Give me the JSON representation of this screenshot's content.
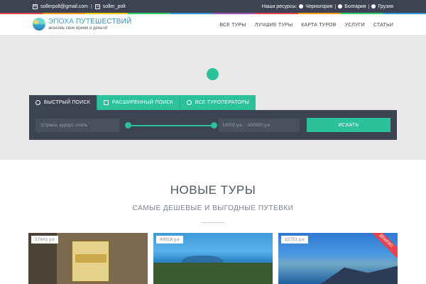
{
  "topbar": {
    "email": "sollerpolt@gmail.com",
    "skype": "soller_polt",
    "resources_label": "Наши ресурсы:",
    "resources": [
      "Черногория",
      "Болгария",
      "Грузия"
    ]
  },
  "colors": {
    "accent": "#2bc19a",
    "dark": "#3d4352",
    "rainbow": [
      "#e8434c",
      "#f39c12",
      "#f1c40f",
      "#2ecc71",
      "#3498db",
      "#9b59b6",
      "#e8434c",
      "#f39c12",
      "#2ecc71",
      "#3498db"
    ]
  },
  "logo": {
    "title_part1": "ЭПОХА",
    "title_part2": "ПУТЕШЕСТВИЙ",
    "subtitle": "экономь свое время и деньги!"
  },
  "nav": [
    "ВСЕ ТУРЫ",
    "ЛУЧШИЕ ТУРЫ",
    "КАРТА ТУРОВ",
    "УСЛУГИ",
    "СТАТЬИ"
  ],
  "search": {
    "tabs": [
      {
        "label": "БЫСТРЫЙ ПОИСК",
        "icon": "search-icon"
      },
      {
        "label": "РАСШИРЕННЫЙ ПОИСК",
        "icon": "filters-icon"
      },
      {
        "label": "ВСЕ ТУРОПЕРАТОРЫ",
        "icon": "globe-icon"
      }
    ],
    "placeholder": "Страна, курорт, отель",
    "range_text": "10000 у.е. - 300000 у.е.",
    "button": "ИСКАТЬ"
  },
  "section": {
    "title": "НОВЫЕ ТУРЫ",
    "subtitle": "САМЫЕ ДЕШЕВЫЕ И ВЫГОДНЫЕ ПУТЕВКИ"
  },
  "cards": [
    {
      "price": "57643 у.е"
    },
    {
      "price": "49918 у.е"
    },
    {
      "price": "32751 у.е",
      "badge": "ДЕШЕВО"
    }
  ]
}
